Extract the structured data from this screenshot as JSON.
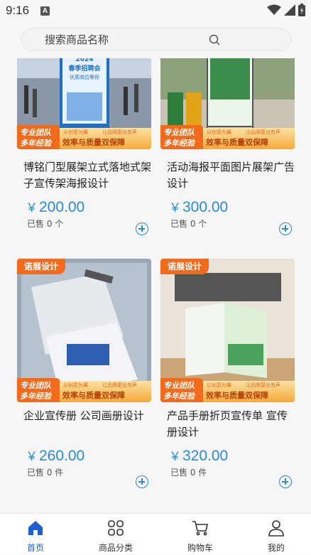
{
  "status": {
    "time": "9:16",
    "notif_letter": "A"
  },
  "search": {
    "placeholder": "搜索商品名称"
  },
  "products": [
    {
      "title": "博铭门型展架立式落地式架子宣传架海报设计",
      "price": "200.00",
      "sold": "已售 0 个",
      "top_tag": "",
      "poster_year": "2024",
      "poster_line1": "春季招聘会",
      "poster_line2": "优质岗位等你"
    },
    {
      "title": "活动海报平面图片展架广告设计",
      "price": "300.00",
      "sold": "已售 0 个",
      "top_tag": ""
    },
    {
      "title": "企业宣传册 公司画册设计",
      "price": "260.00",
      "sold": "已售 0 件",
      "top_tag": "诺展设计"
    },
    {
      "title": "产品手册折页宣传单 宣传册设计",
      "price": "320.00",
      "sold": "已售 0 件",
      "top_tag": "诺展设计"
    }
  ],
  "banner": {
    "left_line1": "专业团队",
    "left_line2": "多年经验",
    "small_a": "以创意为翼",
    "small_b": "让品牌更出有声",
    "main": "效率与质量双保障"
  },
  "currency": "￥",
  "tabs": [
    {
      "label": "首页",
      "icon": "home-icon",
      "active": true
    },
    {
      "label": "商品分类",
      "icon": "category-icon"
    },
    {
      "label": "购物车",
      "icon": "cart-icon"
    },
    {
      "label": "我的",
      "icon": "profile-icon"
    }
  ],
  "colors": {
    "accent": "#2b89d6",
    "orange": "#f26a1b",
    "tab_active": "#1d5fd0"
  }
}
